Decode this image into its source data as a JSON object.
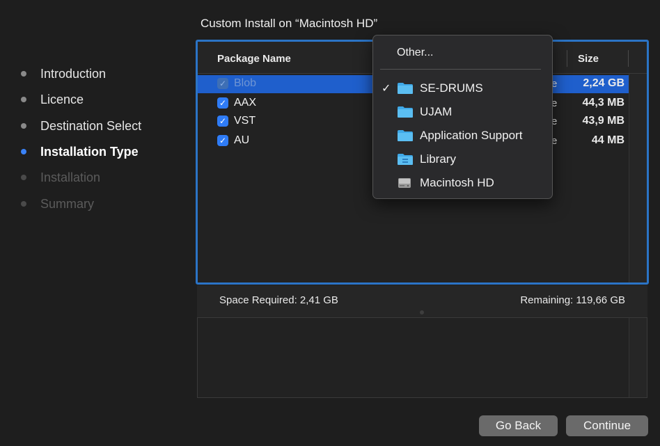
{
  "sidebar": {
    "steps": [
      {
        "label": "Introduction",
        "state": "done"
      },
      {
        "label": "Licence",
        "state": "done"
      },
      {
        "label": "Destination Select",
        "state": "done"
      },
      {
        "label": "Installation Type",
        "state": "active"
      },
      {
        "label": "Installation",
        "state": "pending"
      },
      {
        "label": "Summary",
        "state": "pending"
      }
    ]
  },
  "main": {
    "title": "Custom Install on “Macintosh HD”",
    "table": {
      "headers": {
        "package": "Package Name",
        "size": "Size"
      },
      "rows": [
        {
          "name": "Blob",
          "checked": true,
          "enabled": false,
          "selected": true,
          "location_fragment": "e",
          "size": "2,24 GB"
        },
        {
          "name": "AAX",
          "checked": true,
          "enabled": true,
          "selected": false,
          "location_fragment": "e",
          "size": "44,3 MB"
        },
        {
          "name": "VST",
          "checked": true,
          "enabled": true,
          "selected": false,
          "location_fragment": "e",
          "size": "43,9 MB"
        },
        {
          "name": "AU",
          "checked": true,
          "enabled": true,
          "selected": false,
          "location_fragment": "e",
          "size": "44 MB"
        }
      ]
    },
    "space_required": "Space Required:  2,41 GB",
    "remaining": "Remaining:  119,66 GB"
  },
  "location_menu": {
    "other_label": "Other...",
    "items": [
      {
        "label": "SE-DRUMS",
        "icon": "folder-icon",
        "checked": true
      },
      {
        "label": "UJAM",
        "icon": "folder-icon",
        "checked": false
      },
      {
        "label": "Application Support",
        "icon": "folder-icon",
        "checked": false
      },
      {
        "label": "Library",
        "icon": "library-folder-icon",
        "checked": false
      },
      {
        "label": "Macintosh HD",
        "icon": "hard-drive-icon",
        "checked": false
      }
    ],
    "check_mark": "✓"
  },
  "buttons": {
    "go_back": "Go Back",
    "continue": "Continue"
  },
  "colors": {
    "accent": "#2f7cf6",
    "selection": "#1f5fcc",
    "focus_ring": "#2b74c6",
    "background": "#1e1e1e"
  }
}
